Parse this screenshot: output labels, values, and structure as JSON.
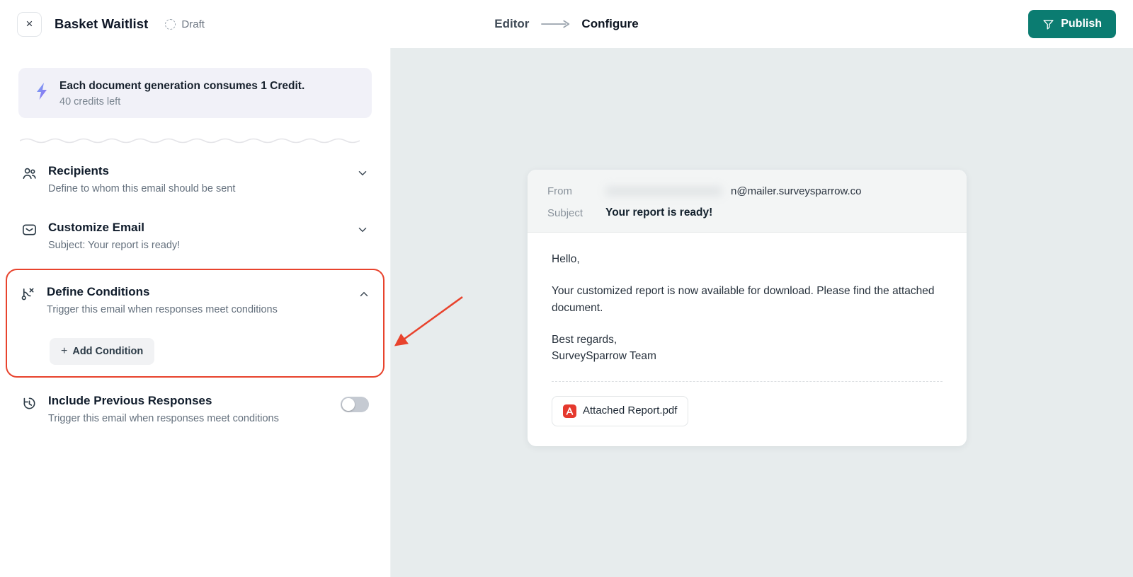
{
  "icons": {
    "close": "×",
    "plus": "+"
  },
  "colors": {
    "publish_teal": "#0b7c71",
    "highlight_red": "#e8432d",
    "main_bg": "#e7eced",
    "credit_bg": "#f1f1f8"
  },
  "topbar": {
    "title": "Basket Waitlist",
    "status": "Draft",
    "steps": {
      "editor": "Editor",
      "configure": "Configure"
    },
    "publish_label": "Publish"
  },
  "sidebar": {
    "credit": {
      "line1": "Each document generation consumes 1 Credit.",
      "line2": "40 credits left"
    },
    "sections": [
      {
        "title": "Recipients",
        "subtitle": "Define to whom this email should be sent"
      },
      {
        "title": "Customize Email",
        "subtitle": "Subject: Your report is ready!"
      },
      {
        "title": "Define Conditions",
        "subtitle": "Trigger this email when responses meet conditions",
        "action": "Add Condition"
      },
      {
        "title": "Include Previous Responses",
        "subtitle": "Trigger this email when responses meet conditions"
      }
    ]
  },
  "email": {
    "from_label": "From",
    "from_value": "n@mailer.surveysparrow.co",
    "subject_label": "Subject",
    "subject_value": "Your report is ready!",
    "body": {
      "greeting": "Hello,",
      "paragraph": "Your customized report is now available for download. Please find the attached document.",
      "signoff_1": "Best regards,",
      "signoff_2": "SurveySparrow Team"
    },
    "attachment_name": "Attached Report.pdf"
  }
}
